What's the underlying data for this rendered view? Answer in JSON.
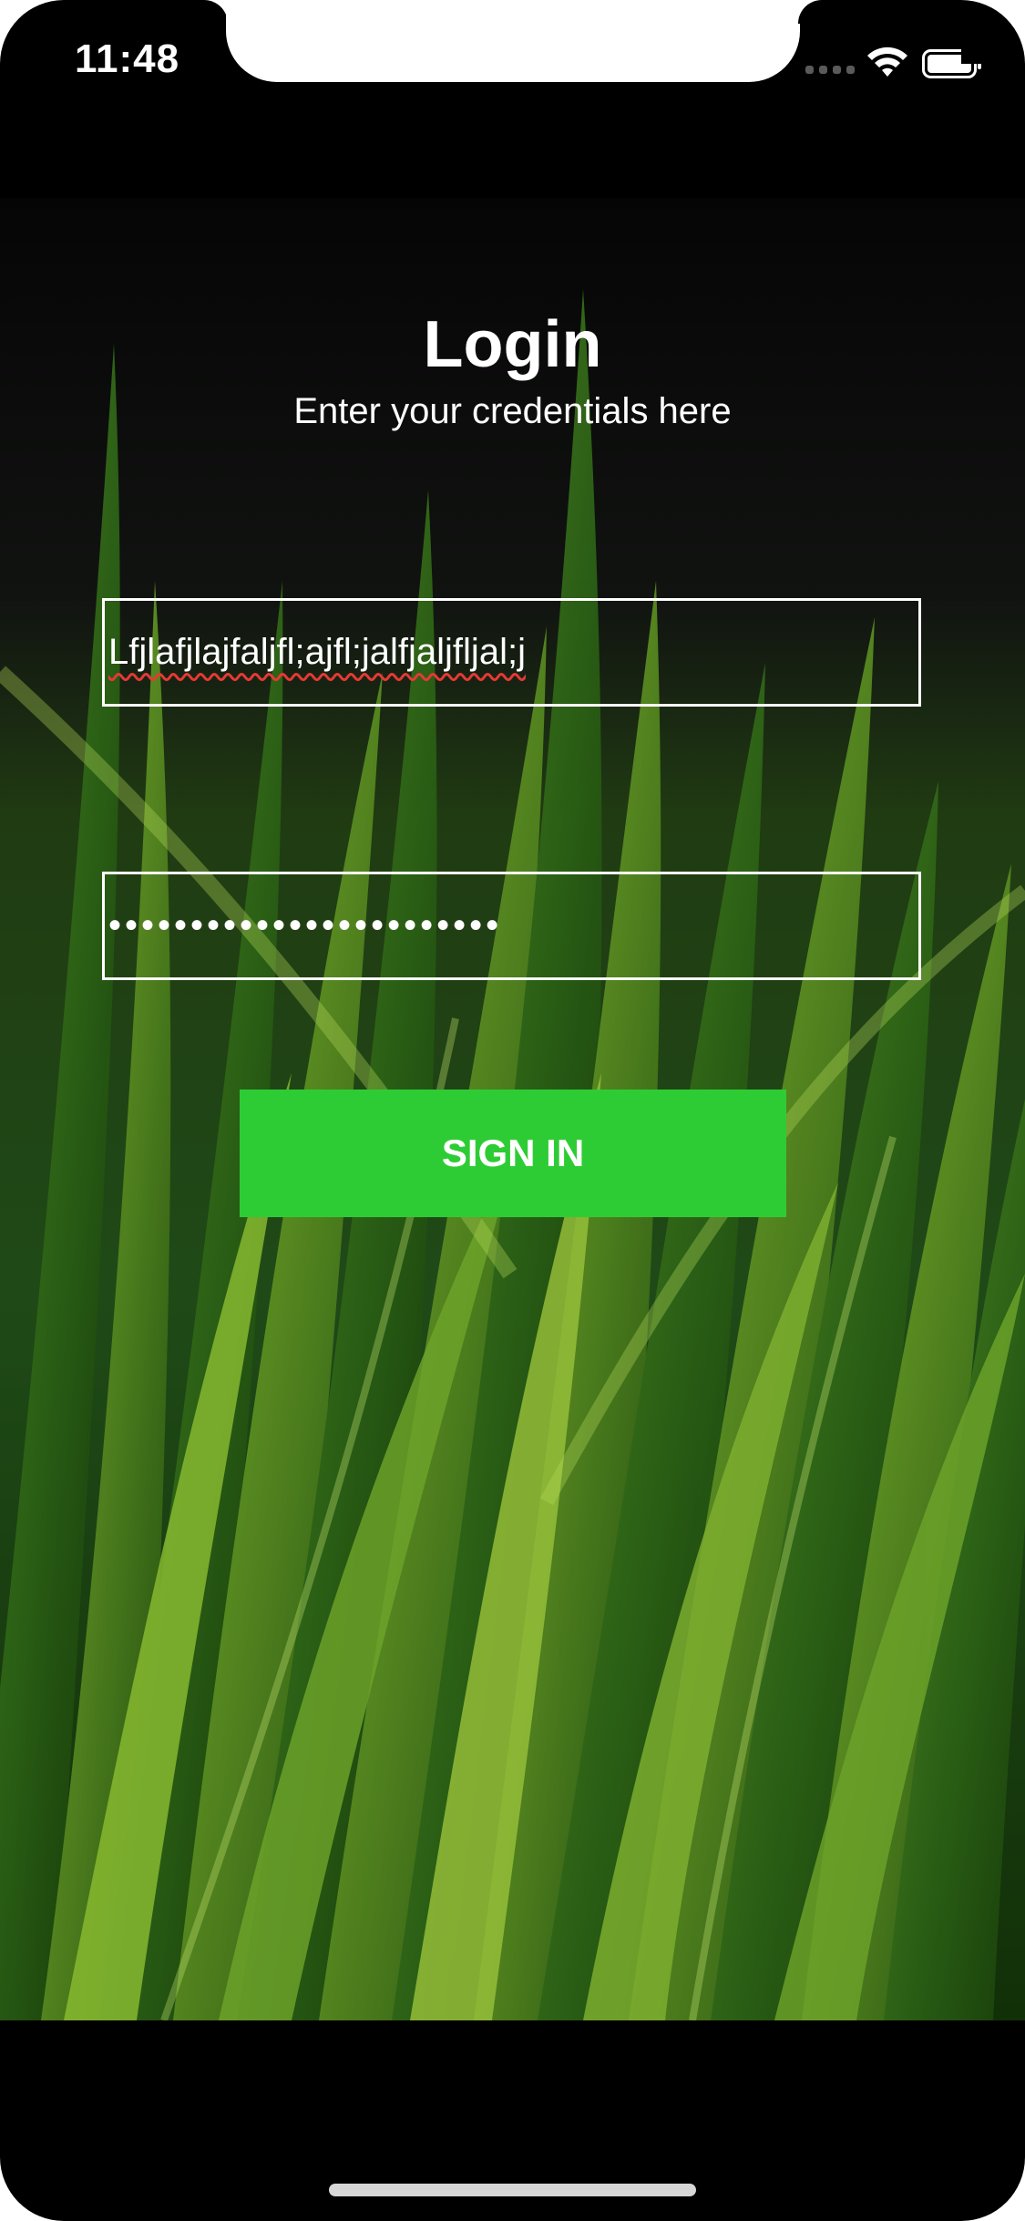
{
  "status_bar": {
    "time": "11:48",
    "signal_icon": "cellular-signal-icon",
    "wifi_icon": "wifi-icon",
    "battery_icon": "battery-icon"
  },
  "login": {
    "title": "Login",
    "subtitle": "Enter your credentials here",
    "email_value": "Lfjlafjlajfaljfl;ajfl;jalfjaljfljal;j",
    "password_value": "••••••••••••••••••••••••",
    "sign_in_label": "SIGN IN"
  },
  "colors": {
    "button_background": "#2ecc34",
    "text": "#ffffff",
    "spellcheck_underline": "#e53935"
  }
}
